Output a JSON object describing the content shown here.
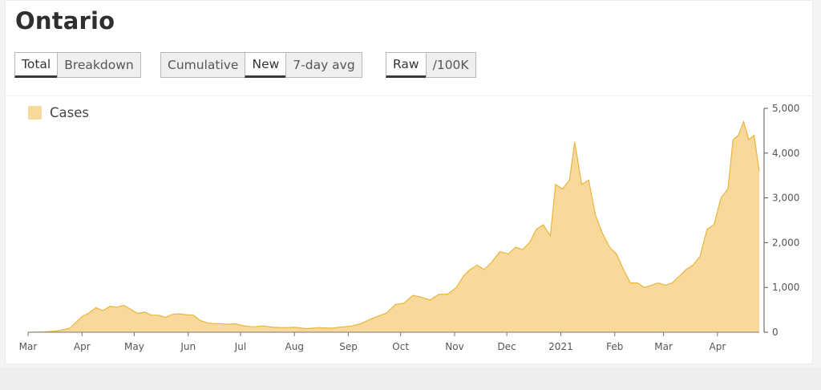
{
  "page": {
    "title": "Ontario"
  },
  "controls": {
    "group1": [
      {
        "label": "Total",
        "active": true
      },
      {
        "label": "Breakdown",
        "active": false
      }
    ],
    "group2": [
      {
        "label": "Cumulative",
        "active": false
      },
      {
        "label": "New",
        "active": true
      },
      {
        "label": "7-day avg",
        "active": false
      }
    ],
    "group3": [
      {
        "label": "Raw",
        "active": true
      },
      {
        "label": "/100K",
        "active": false
      }
    ]
  },
  "colors": {
    "area_fill": "#f9d89b",
    "area_line": "#e8b53d"
  },
  "chart_data": {
    "type": "area",
    "legend": [
      "Cases"
    ],
    "legend_position": "top-left",
    "grid": false,
    "y_axis_side": "right",
    "ylim": [
      0,
      5000
    ],
    "y_ticks": [
      "0",
      "1,000",
      "2,000",
      "3,000",
      "4,000",
      "5,000"
    ],
    "x_ticks": [
      "Mar",
      "Apr",
      "May",
      "Jun",
      "Jul",
      "Aug",
      "Sep",
      "Oct",
      "Nov",
      "Dec",
      "2021",
      "Feb",
      "Mar",
      "Apr"
    ],
    "x_range": [
      "2020-03-01",
      "2021-04-25"
    ],
    "series": [
      {
        "name": "Cases",
        "points": [
          [
            "2020-03-01",
            0
          ],
          [
            "2020-03-10",
            5
          ],
          [
            "2020-03-18",
            30
          ],
          [
            "2020-03-25",
            90
          ],
          [
            "2020-04-01",
            350
          ],
          [
            "2020-04-05",
            430
          ],
          [
            "2020-04-09",
            550
          ],
          [
            "2020-04-13",
            480
          ],
          [
            "2020-04-17",
            580
          ],
          [
            "2020-04-21",
            560
          ],
          [
            "2020-04-25",
            600
          ],
          [
            "2020-04-29",
            510
          ],
          [
            "2020-05-03",
            420
          ],
          [
            "2020-05-07",
            450
          ],
          [
            "2020-05-11",
            380
          ],
          [
            "2020-05-15",
            380
          ],
          [
            "2020-05-19",
            330
          ],
          [
            "2020-05-23",
            400
          ],
          [
            "2020-05-27",
            410
          ],
          [
            "2020-05-31",
            390
          ],
          [
            "2020-06-04",
            380
          ],
          [
            "2020-06-08",
            260
          ],
          [
            "2020-06-12",
            210
          ],
          [
            "2020-06-16",
            190
          ],
          [
            "2020-06-20",
            190
          ],
          [
            "2020-06-24",
            175
          ],
          [
            "2020-06-28",
            190
          ],
          [
            "2020-07-02",
            150
          ],
          [
            "2020-07-08",
            120
          ],
          [
            "2020-07-14",
            140
          ],
          [
            "2020-07-20",
            110
          ],
          [
            "2020-07-26",
            100
          ],
          [
            "2020-08-01",
            110
          ],
          [
            "2020-08-08",
            80
          ],
          [
            "2020-08-15",
            100
          ],
          [
            "2020-08-22",
            90
          ],
          [
            "2020-08-29",
            120
          ],
          [
            "2020-09-03",
            140
          ],
          [
            "2020-09-08",
            190
          ],
          [
            "2020-09-13",
            280
          ],
          [
            "2020-09-18",
            360
          ],
          [
            "2020-09-23",
            430
          ],
          [
            "2020-09-28",
            620
          ],
          [
            "2020-10-03",
            650
          ],
          [
            "2020-10-08",
            820
          ],
          [
            "2020-10-13",
            780
          ],
          [
            "2020-10-18",
            720
          ],
          [
            "2020-10-23",
            850
          ],
          [
            "2020-10-28",
            850
          ],
          [
            "2020-11-02",
            1000
          ],
          [
            "2020-11-06",
            1250
          ],
          [
            "2020-11-10",
            1400
          ],
          [
            "2020-11-14",
            1500
          ],
          [
            "2020-11-18",
            1400
          ],
          [
            "2020-11-22",
            1550
          ],
          [
            "2020-11-27",
            1800
          ],
          [
            "2020-12-02",
            1750
          ],
          [
            "2020-12-06",
            1900
          ],
          [
            "2020-12-10",
            1850
          ],
          [
            "2020-12-14",
            2000
          ],
          [
            "2020-12-18",
            2300
          ],
          [
            "2020-12-22",
            2400
          ],
          [
            "2020-12-26",
            2150
          ],
          [
            "2020-12-29",
            3300
          ],
          [
            "2021-01-02",
            3200
          ],
          [
            "2021-01-06",
            3400
          ],
          [
            "2021-01-09",
            4250
          ],
          [
            "2021-01-13",
            3300
          ],
          [
            "2021-01-17",
            3400
          ],
          [
            "2021-01-21",
            2600
          ],
          [
            "2021-01-25",
            2200
          ],
          [
            "2021-01-29",
            1900
          ],
          [
            "2021-02-02",
            1750
          ],
          [
            "2021-02-06",
            1400
          ],
          [
            "2021-02-10",
            1100
          ],
          [
            "2021-02-14",
            1100
          ],
          [
            "2021-02-18",
            1000
          ],
          [
            "2021-02-22",
            1050
          ],
          [
            "2021-02-26",
            1100
          ],
          [
            "2021-03-02",
            1050
          ],
          [
            "2021-03-06",
            1100
          ],
          [
            "2021-03-10",
            1250
          ],
          [
            "2021-03-14",
            1400
          ],
          [
            "2021-03-18",
            1500
          ],
          [
            "2021-03-22",
            1700
          ],
          [
            "2021-03-26",
            2300
          ],
          [
            "2021-03-30",
            2400
          ],
          [
            "2021-04-03",
            3000
          ],
          [
            "2021-04-07",
            3200
          ],
          [
            "2021-04-10",
            4300
          ],
          [
            "2021-04-13",
            4400
          ],
          [
            "2021-04-16",
            4700
          ],
          [
            "2021-04-19",
            4300
          ],
          [
            "2021-04-22",
            4400
          ],
          [
            "2021-04-25",
            3600
          ]
        ]
      }
    ]
  }
}
